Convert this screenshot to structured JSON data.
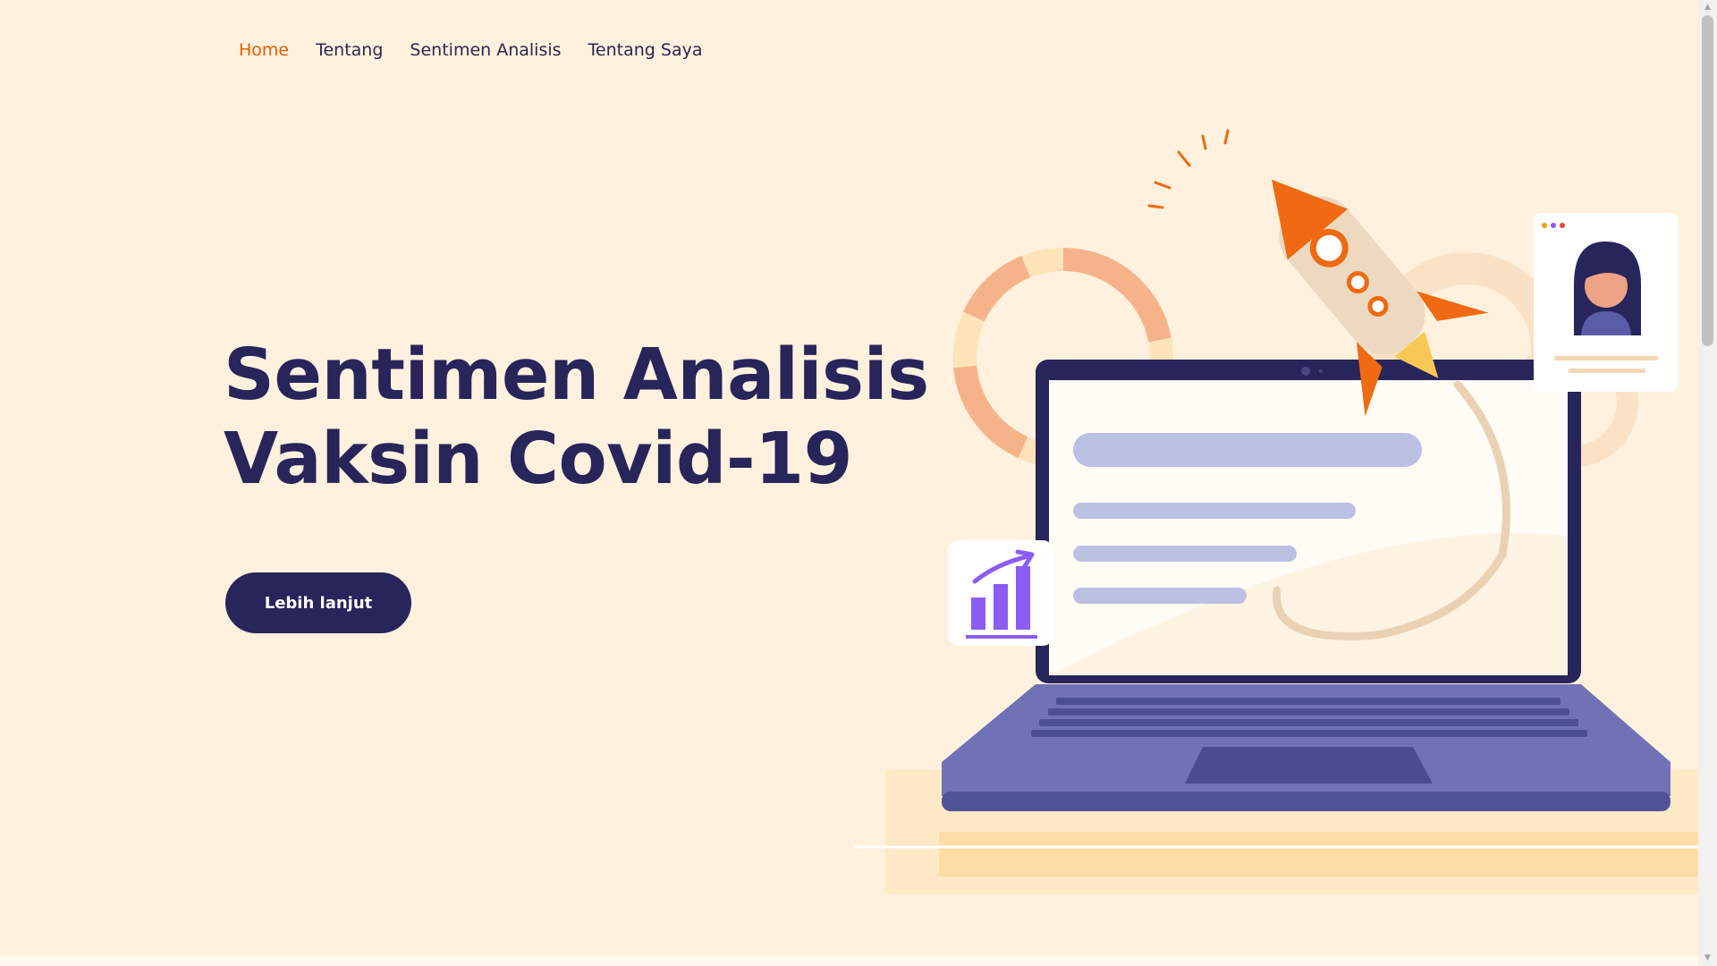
{
  "nav": {
    "items": [
      {
        "label": "Home",
        "active": true
      },
      {
        "label": "Tentang",
        "active": false
      },
      {
        "label": "Sentimen Analisis",
        "active": false
      },
      {
        "label": "Tentang Saya",
        "active": false
      }
    ]
  },
  "hero": {
    "title_line1": "Sentimen Analisis",
    "title_line2": "Vaksin Covid-19",
    "cta_label": "Lebih lanjut"
  },
  "illustration": {
    "icons": [
      "rocket-icon",
      "laptop-icon",
      "bar-chart-icon",
      "profile-card-icon",
      "donut-chart-icon",
      "gear-icon"
    ]
  },
  "colors": {
    "background": "#fff1de",
    "primary": "#27255a",
    "accent": "#e85d04",
    "laptop": "#7072b5",
    "chart_purple": "#8b5cf6"
  }
}
